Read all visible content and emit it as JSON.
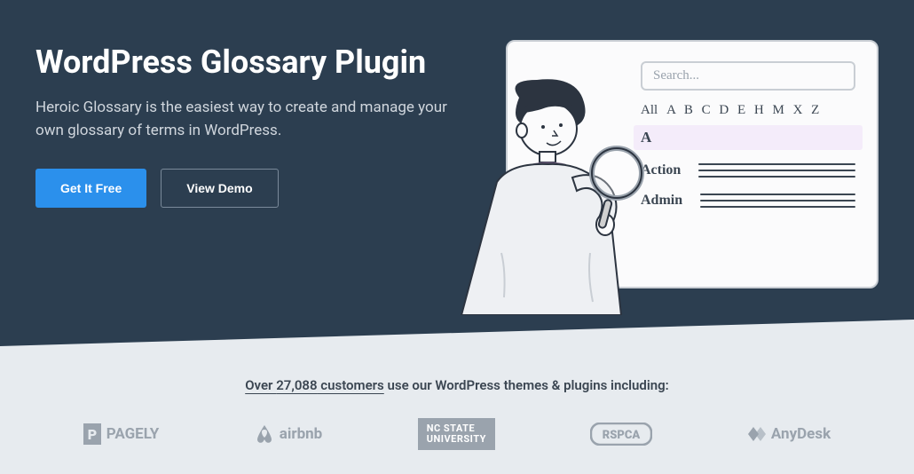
{
  "hero": {
    "title": "WordPress Glossary Plugin",
    "subtitle": "Heroic Glossary is the easiest way to create and manage your own glossary of terms in WordPress.",
    "cta_primary": "Get It Free",
    "cta_secondary": "View Demo"
  },
  "illus": {
    "search_placeholder": "Search...",
    "letters_all": "All",
    "letters": "A B C D E H M X Z",
    "selected_letter": "A",
    "entries": [
      "Action",
      "Admin"
    ]
  },
  "social": {
    "count": "27,088",
    "prefix": "Over ",
    "mid": " customers",
    "suffix": " use our WordPress themes & plugins including:",
    "logos": {
      "pagely": "PAGELY",
      "airbnb": "airbnb",
      "ncstate_1": "NC STATE",
      "ncstate_2": "UNIVERSITY",
      "rspca": "RSPCA",
      "anydesk": "AnyDesk"
    }
  }
}
